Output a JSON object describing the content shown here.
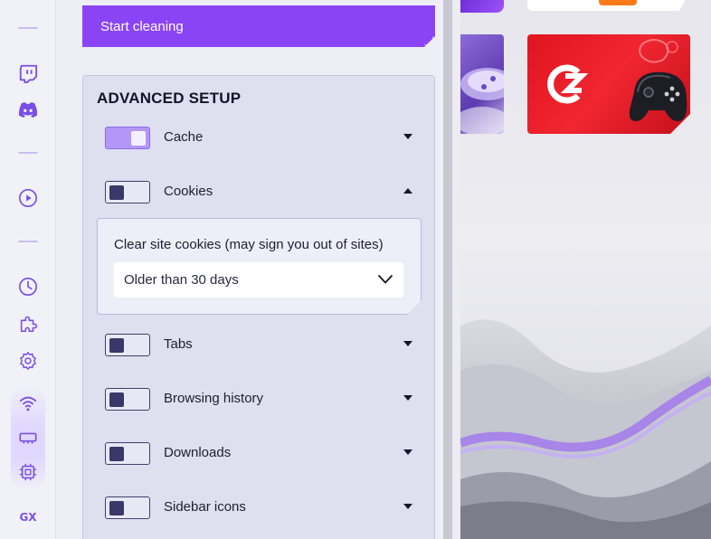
{
  "sidebar": {
    "items": [
      {
        "name": "twitch-icon"
      },
      {
        "name": "discord-icon"
      },
      {
        "name": "player-icon"
      },
      {
        "name": "history-icon"
      },
      {
        "name": "extensions-icon"
      },
      {
        "name": "settings-icon"
      },
      {
        "name": "network-limiter-icon"
      },
      {
        "name": "ram-limiter-icon"
      },
      {
        "name": "cpu-limiter-icon"
      }
    ],
    "gx_label": "GX"
  },
  "panel": {
    "start_button_label": "Start cleaning",
    "advanced_title": "ADVANCED SETUP",
    "options": [
      {
        "label": "Cache",
        "enabled": true,
        "expanded": false
      },
      {
        "label": "Cookies",
        "enabled": false,
        "expanded": true
      },
      {
        "label": "Tabs",
        "enabled": false,
        "expanded": false
      },
      {
        "label": "Browsing history",
        "enabled": false,
        "expanded": false
      },
      {
        "label": "Downloads",
        "enabled": false,
        "expanded": false
      },
      {
        "label": "Sidebar icons",
        "enabled": false,
        "expanded": false
      }
    ],
    "cookies_detail": {
      "label": "Clear site cookies (may sign you out of sites)",
      "selected": "Older than 30 days"
    }
  },
  "colors": {
    "accent": "#8b44f5",
    "toggle_on": "#b496f6",
    "toggle_knob": "#38386a",
    "card_red": "#e1141f"
  }
}
